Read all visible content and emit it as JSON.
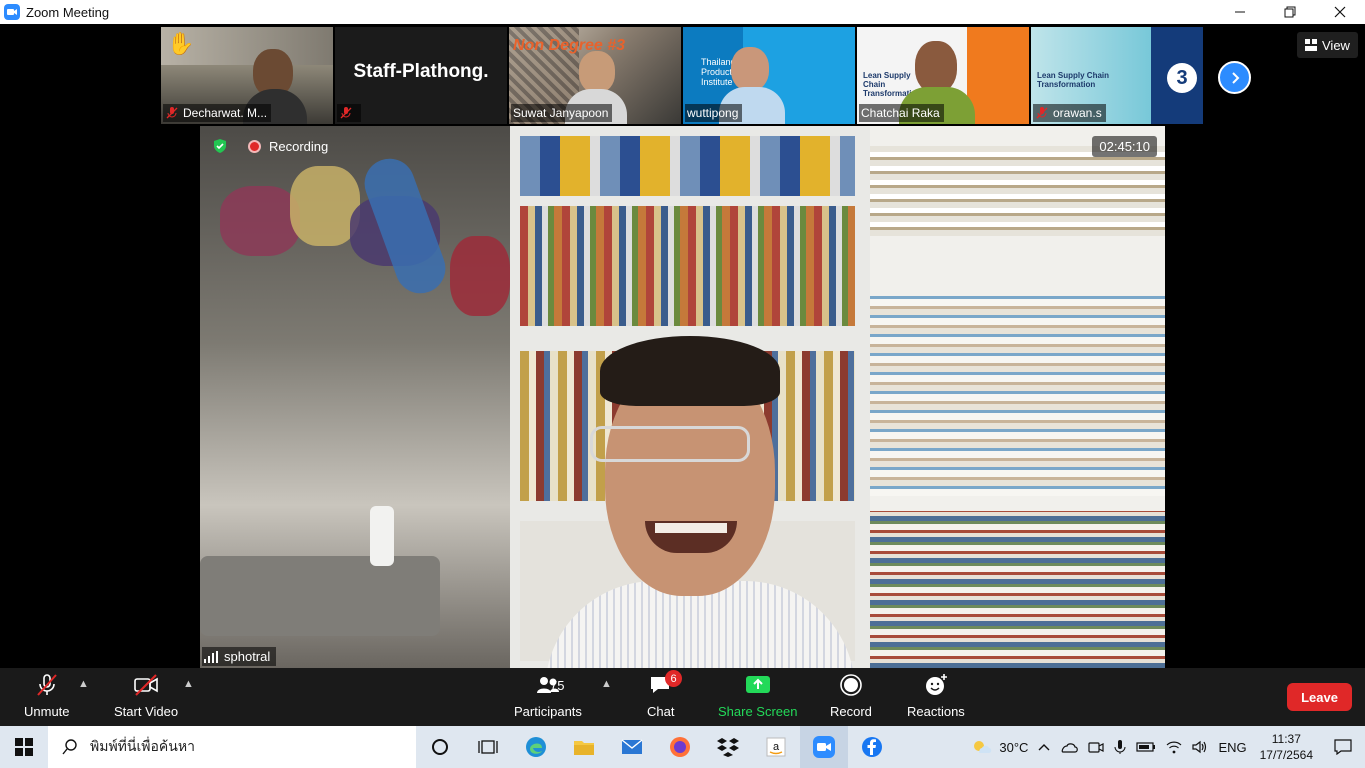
{
  "window": {
    "title": "Zoom Meeting"
  },
  "gallery": {
    "tiles": [
      {
        "name": "Decharwat. M...",
        "muted": true,
        "hand_raised": true
      },
      {
        "name": "",
        "center_text": "Staff-Plathong.",
        "muted": true
      },
      {
        "name": "Suwat Janyapoon",
        "muted": false,
        "slide_text": "Non Degree #3"
      },
      {
        "name": "wuttipong",
        "muted": false,
        "slide_text": "Thailand Productivity Institute"
      },
      {
        "name": "Chatchai Raka",
        "muted": false,
        "slide_text": "Lean Supply Chain Transformation"
      },
      {
        "name": "orawan.s",
        "muted": true,
        "slide_text": "Lean Supply Chain Transformation"
      }
    ],
    "view_label": "View"
  },
  "speaker": {
    "name": "sphotral",
    "recording_label": "Recording",
    "elapsed": "02:45:10"
  },
  "toolbar": {
    "unmute": "Unmute",
    "start_video": "Start Video",
    "participants": "Participants",
    "participants_count": "75",
    "chat": "Chat",
    "chat_badge": "6",
    "share_screen": "Share Screen",
    "record": "Record",
    "reactions": "Reactions",
    "leave": "Leave"
  },
  "taskbar": {
    "search_placeholder": "พิมพ์ที่นี่เพื่อค้นหา",
    "weather": "30°C",
    "language": "ENG",
    "time": "11:37",
    "date": "17/7/2564"
  },
  "colors": {
    "zoom_blue": "#2D8CFF",
    "leave_red": "#E02828",
    "share_green": "#23D959"
  }
}
